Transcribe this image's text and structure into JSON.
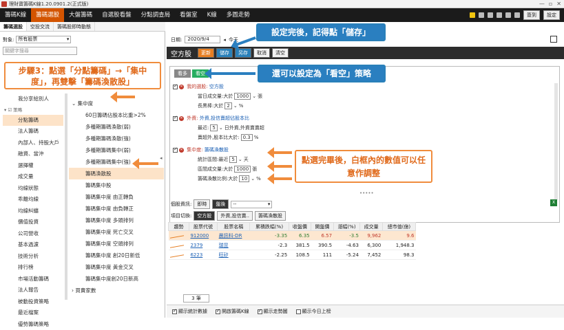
{
  "window": {
    "title": "理財寶籌碼K線1.20.0901.2(正式版)"
  },
  "menu": {
    "items": [
      "籌碼K線",
      "籌碼選股",
      "大盤籌碼",
      "自選股看盤",
      "分點調查局",
      "看盤室",
      "K線",
      "多圖走勢"
    ],
    "active_index": 1,
    "right_buttons": [
      "簽到",
      "設定"
    ]
  },
  "subtabs": [
    "籌碼選股",
    "空投交流",
    "籌碼股即時動態"
  ],
  "left": {
    "object_label": "對象:",
    "object_value": "所有股票",
    "search_placeholder": "關鍵字搜尋",
    "col1_group": "策略",
    "col1_top_item": "我分享給別人",
    "col1_items": [
      "分點籌碼",
      "法人籌碼",
      "內部人、持股大戶",
      "融資、當沖",
      "選擇權",
      "成交量",
      "均線狀態",
      "乖離均線",
      "均線糾纏",
      "價值投資",
      "公司營收",
      "基本過濾",
      "技術分析",
      "排行榜",
      "市場活動籌碼",
      "法人報告",
      "被動投資策略",
      "最近檔案",
      "優勢籌碼策略"
    ],
    "col1_selected_index": 0,
    "col2_group": "集中度",
    "col2_items": [
      "60日籌碼佔股本比重>2%",
      "多種期籌碼渙散(弱)",
      "多種期籌碼渙散(強)",
      "多種期籌碼集中(弱)",
      "多種期籌碼集中(強)",
      "籌碼渙散股",
      "籌碼集中股",
      "籌碼集中度 由正轉負",
      "籌碼集中度 由負轉正",
      "籌碼集中度 多頭排列",
      "籌碼集中度 死亡交叉",
      "籌碼集中度 空頭排列",
      "籌碼集中度 創20日新低",
      "籌碼集中度 黃金交叉",
      "籌碼集中度創20日新高"
    ],
    "col2_selected_index": 5,
    "col2_bottom_group": "買賣家數"
  },
  "right": {
    "date_label": "日期:",
    "date_value": "2020/9/4",
    "date_unit": "今天",
    "strategy_title": "空方股",
    "buttons": {
      "update": "更新",
      "save": "儲存",
      "save_as": "另存",
      "cancel": "取消",
      "clear": "清空"
    },
    "long_label": "看多",
    "short_label": "看空",
    "conditions": [
      {
        "title": "我的選股:",
        "name": "空方股",
        "lines": [
          {
            "label": "當日成交量:大於",
            "value": "1000",
            "unit": "張"
          },
          {
            "label": "長黑棒:大於",
            "value": "2",
            "unit": "%"
          }
        ]
      },
      {
        "title": "外資:",
        "name": "外資,投信賣超佔股本比",
        "lines": [
          {
            "label": "最近:",
            "value": "5",
            "unit": "日外資,外資賣賣超"
          },
          {
            "label": "賣超外,股本比大於:",
            "value": "0.3",
            "unit": "%"
          }
        ]
      },
      {
        "title": "集中度:",
        "name": "籌碼渙散股",
        "lines": [
          {
            "label": "統計區間:最近",
            "value": "5",
            "unit": "天"
          },
          {
            "label": "區間成交量:大於",
            "value": "1000",
            "unit": "張"
          },
          {
            "label": "籌碼渙散比例:大於",
            "value": "10",
            "unit": "%"
          }
        ]
      }
    ],
    "stock_info_label": "個股資訊:",
    "stock_info_btns": [
      "即時",
      "盤後"
    ],
    "stock_info_select": "--",
    "project_label": "項目切換:",
    "project_tabs": [
      "空方股",
      "外資,投信賣..",
      "籌碼渙散股"
    ],
    "table": {
      "headers": [
        "趨勢",
        "股票代號",
        "股票名稱",
        "累積跌幅(%)",
        "收盤價",
        "開盤價",
        "漲幅(%)",
        "成交量",
        "總市值(億)"
      ],
      "rows": [
        [
          "",
          "912000",
          "晨訊科-DR",
          "-3.35",
          "6.35",
          "6.57",
          "-3.5",
          "9,962",
          "9.6"
        ],
        [
          "",
          "2379",
          "瑞昱",
          "-2.3",
          "381.5",
          "390.5",
          "-4.63",
          "6,300",
          "1,948.3"
        ],
        [
          "",
          "6223",
          "旺矽",
          "-2.25",
          "108.5",
          "111",
          "-5.24",
          "7,452",
          "98.3"
        ]
      ]
    },
    "count": "3 筆",
    "bottom_checks": [
      "顯示統計數據",
      "開啟籌碼K線",
      "顯示走勢圖",
      "顯示今日上榜"
    ]
  },
  "callouts": {
    "left": "步驟3：點選「分點籌碼」→「集中度」，再雙擊「籌碼渙散股」",
    "top": "設定完後，記得點「儲存」",
    "short": "還可以設定為「看空」策略",
    "values": "點選完畢後，白框內的數值可以任意作調整"
  },
  "colors": {
    "accent": "#d35400",
    "callout_orange": "#f08c3c",
    "callout_blue": "#2a7fc0"
  }
}
